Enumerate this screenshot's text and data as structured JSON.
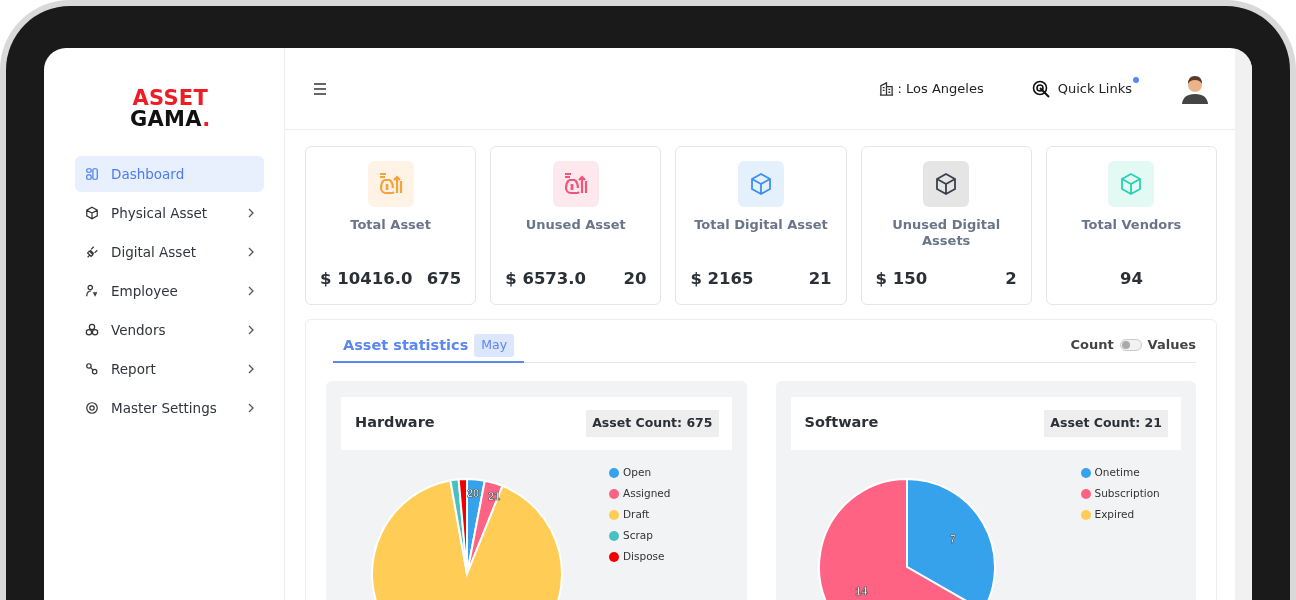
{
  "logo": {
    "top": "ASSET",
    "bottom": "GAMA",
    "accent": "."
  },
  "sidebar": {
    "items": [
      {
        "label": "Dashboard",
        "selected": true,
        "expandable": false
      },
      {
        "label": "Physical Asset",
        "selected": false,
        "expandable": true
      },
      {
        "label": "Digital Asset",
        "selected": false,
        "expandable": true
      },
      {
        "label": "Employee",
        "selected": false,
        "expandable": true
      },
      {
        "label": "Vendors",
        "selected": false,
        "expandable": true
      },
      {
        "label": "Report",
        "selected": false,
        "expandable": true
      },
      {
        "label": "Master Settings",
        "selected": false,
        "expandable": true
      }
    ]
  },
  "header": {
    "location": ": Los Angeles",
    "quick_links": {
      "label": "Quick Links",
      "notification": true
    }
  },
  "cards": [
    {
      "title": "Total Asset",
      "amount": "$ 10416.0",
      "count": "675",
      "kind": "money",
      "color": "#f7a23b"
    },
    {
      "title": "Unused Asset",
      "amount": "$ 6573.0",
      "count": "20",
      "kind": "money",
      "color": "#f2557a"
    },
    {
      "title": "Total Digital Asset",
      "amount": "$ 2165",
      "count": "21",
      "kind": "cube",
      "color": "#3d8ef0"
    },
    {
      "title": "Unused Digital Assets",
      "amount": "$ 150",
      "count": "2",
      "kind": "cube",
      "color": "#3a3f47"
    },
    {
      "title": "Total Vendors",
      "count": "94",
      "kind": "cube",
      "color": "#2ad1b0"
    }
  ],
  "statistics": {
    "tab": {
      "label": "Asset statistics",
      "badge": "May",
      "selected": true
    },
    "toggle": {
      "left_label": "Count",
      "right_label": "Values",
      "on": false
    },
    "panels": [
      {
        "title": "Hardware",
        "count_label": "Asset Count: 675",
        "chart_data": {
          "type": "pie",
          "categories": [
            "Open",
            "Assigned",
            "Draft",
            "Scrap",
            "Dispose"
          ],
          "series": [
            {
              "values": [
                3.0,
                3.1,
                91.1,
                1.4,
                1.4
              ]
            }
          ],
          "colors": [
            "#36a2eb",
            "#ff6384",
            "#ffcd56",
            "#4bc0c0",
            "#f00000"
          ],
          "value_labels": [
            "20",
            "21",
            null,
            null,
            null
          ],
          "legend": true
        }
      },
      {
        "title": "Software",
        "count_label": "Asset Count: 21",
        "chart_data": {
          "type": "pie",
          "categories": [
            "Onetime",
            "Subscription",
            "Expired"
          ],
          "series": [
            {
              "values": [
                33.3,
                66.7,
                0
              ]
            }
          ],
          "colors": [
            "#36a2eb",
            "#ff6384",
            "#ffcd56"
          ],
          "value_labels": [
            "7",
            "14",
            null
          ],
          "legend": true
        }
      }
    ]
  }
}
